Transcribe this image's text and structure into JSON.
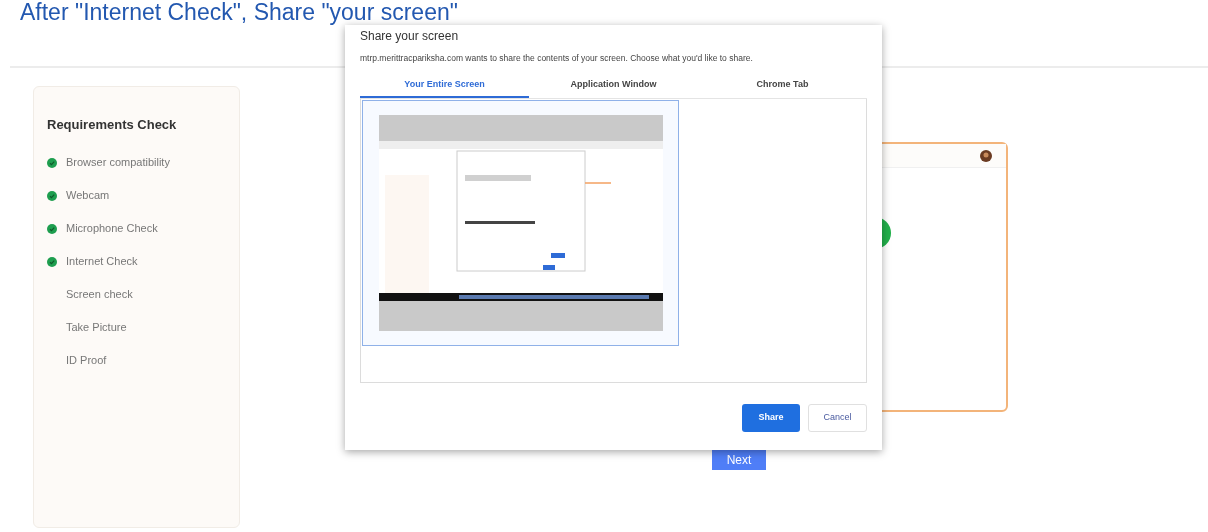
{
  "heading": "After \"Internet Check\", Share \"your screen\"",
  "requirements": {
    "title": "Requirements Check",
    "items": [
      {
        "label": "Browser compatibility",
        "checked": true
      },
      {
        "label": "Webcam",
        "checked": true
      },
      {
        "label": "Microphone Check",
        "checked": true
      },
      {
        "label": "Internet Check",
        "checked": true
      },
      {
        "label": "Screen check",
        "checked": false
      },
      {
        "label": "Take Picture",
        "checked": false
      },
      {
        "label": "ID Proof",
        "checked": false
      }
    ]
  },
  "next_button": "Next",
  "dialog": {
    "title": "Share your screen",
    "message": "mtrp.merittracpariksha.com wants to share the contents of your screen. Choose what you'd like to share.",
    "tabs": [
      {
        "label": "Your Entire Screen",
        "selected": true
      },
      {
        "label": "Application Window",
        "selected": false
      },
      {
        "label": "Chrome Tab",
        "selected": false
      }
    ],
    "screens": [
      {
        "kind": "picture",
        "selected": true
      }
    ],
    "buttons": [
      {
        "label": "Share",
        "kind": "primary"
      },
      {
        "label": "Cancel",
        "kind": "secondary"
      }
    ]
  }
}
